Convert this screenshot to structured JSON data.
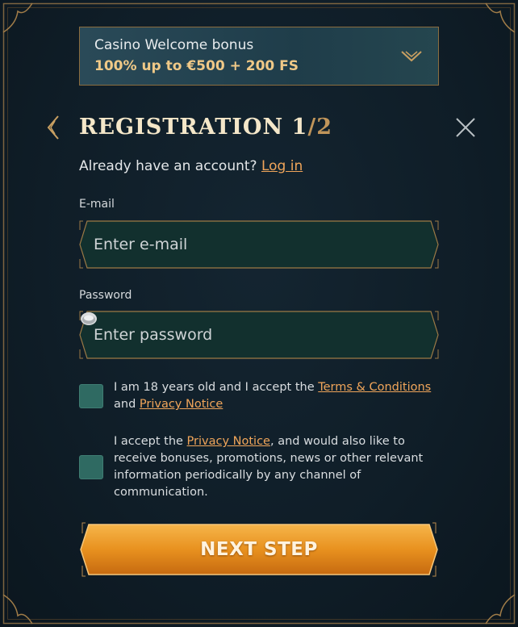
{
  "bonus": {
    "title": "Casino Welcome bonus",
    "offer": "100% up to €500 + 200 FS"
  },
  "header": {
    "title_main": "REGISTRATION 1",
    "title_total": "/2"
  },
  "login": {
    "prompt": "Already have an account?",
    "link": "Log in"
  },
  "email": {
    "label": "E-mail",
    "placeholder": "Enter e-mail",
    "value": ""
  },
  "password": {
    "label": "Password",
    "placeholder": "Enter password",
    "value": ""
  },
  "consent_age": {
    "text_before": "I am 18 years old and I accept the ",
    "terms_link": "Terms & Conditions",
    "text_and": "and ",
    "privacy_link": "Privacy Notice"
  },
  "consent_marketing": {
    "text_before": "I accept the ",
    "privacy_link": "Privacy Notice",
    "text_after": ", and would also like to receive bonuses, promotions, news or other relevant information periodically by any channel of communication."
  },
  "next_button": {
    "label": "NEXT STEP"
  },
  "icons": {
    "bonus_toggle": "chevron-down-icon",
    "back": "chevron-left-icon",
    "close": "close-icon",
    "password_visibility": "eye-icon"
  },
  "colors": {
    "background": "#0e1b24",
    "accent_gold": "#c0955a",
    "link_orange": "#f0a55a",
    "input_fill": "#12302e",
    "checkbox": "#2f6a62",
    "button_orange": "#e08a1e"
  }
}
